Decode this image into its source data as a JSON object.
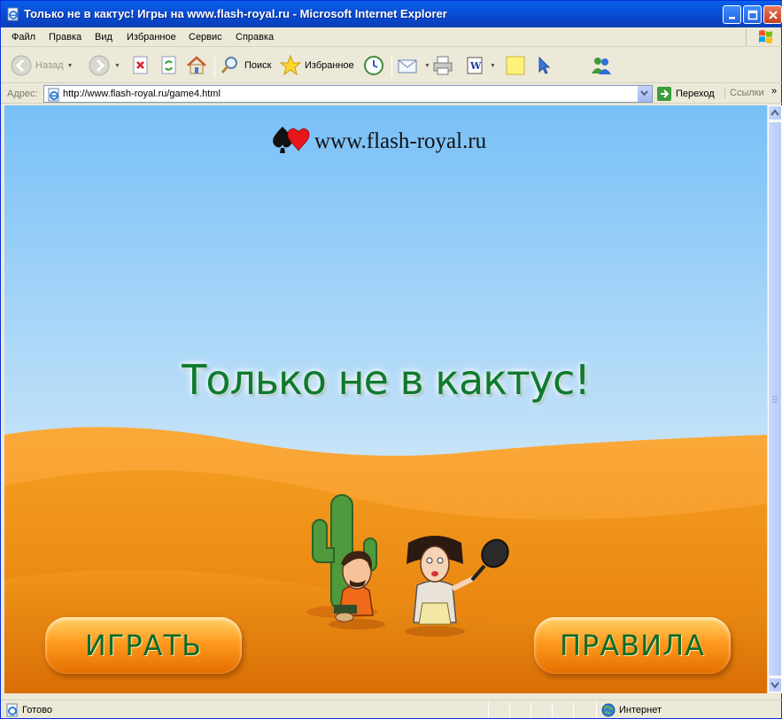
{
  "window": {
    "title": "Только не в кактус! Игры на www.flash-royal.ru - Microsoft Internet Explorer"
  },
  "menu": {
    "items": [
      "Файл",
      "Правка",
      "Вид",
      "Избранное",
      "Сервис",
      "Справка"
    ]
  },
  "toolbar": {
    "back_label": "Назад",
    "search_label": "Поиск",
    "favorites_label": "Избранное"
  },
  "address": {
    "label": "Адрес:",
    "url": "http://www.flash-royal.ru/game4.html",
    "go_label": "Переход",
    "links_label": "Ссылки"
  },
  "game": {
    "site_logo_text": "www.flash-royal.ru",
    "title": "Только не в кактус!",
    "play_button": "ИГРАТЬ",
    "rules_button": "ПРАВИЛА"
  },
  "status": {
    "text": "Готово",
    "zone": "Интернет"
  },
  "colors": {
    "title_bar": "#0A5FEB",
    "sky_top": "#78C0F8",
    "sand": "#F59A1A",
    "title_green": "#0F7A2F"
  }
}
